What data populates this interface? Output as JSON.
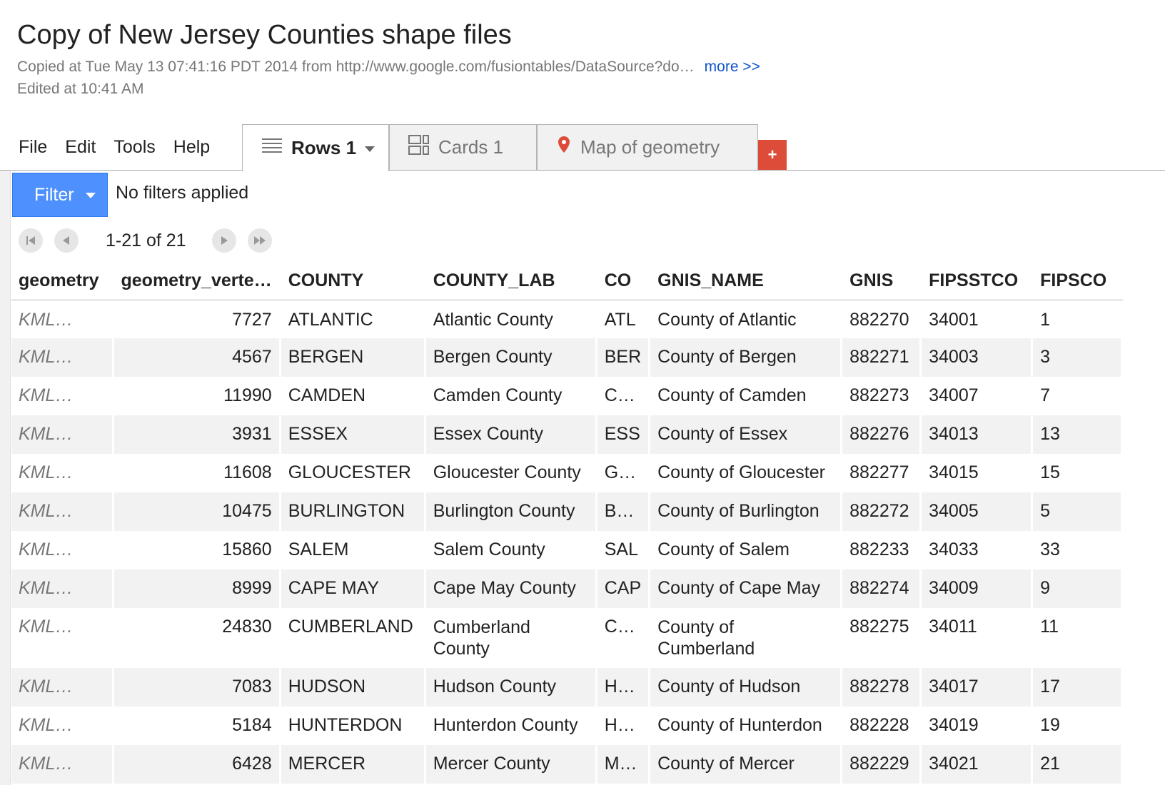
{
  "header": {
    "title": "Copy of New Jersey Counties shape files",
    "copied_text": "Copied at Tue May 13 07:41:16 PDT 2014 from http://www.google.com/fusiontables/DataSource?do…",
    "more_link": "more >>",
    "edited_text": "Edited at 10:41 AM"
  },
  "menu": {
    "items": [
      "File",
      "Edit",
      "Tools",
      "Help"
    ]
  },
  "tabs": [
    {
      "label": "Rows 1",
      "icon": "rows-list-icon",
      "active": true
    },
    {
      "label": "Cards 1",
      "icon": "cards-icon",
      "active": false
    },
    {
      "label": "Map of geometry",
      "icon": "map-pin-icon",
      "active": false
    }
  ],
  "add_tab_label": "+",
  "filter": {
    "button_label": "Filter",
    "status": "No filters applied"
  },
  "pager": {
    "range_text": "1-21 of 21"
  },
  "colors": {
    "filter_button": "#4d90fe",
    "add_tab": "#dd4b39",
    "link": "#1155cc",
    "map_pin": "#dd4b39"
  },
  "table": {
    "columns": [
      "geometry",
      "geometry_verte…",
      "COUNTY",
      "COUNTY_LAB",
      "CO",
      "GNIS_NAME",
      "GNIS",
      "FIPSSTCO",
      "FIPSCO"
    ],
    "rows": [
      [
        "KML…",
        "7727",
        "ATLANTIC",
        "Atlantic County",
        "ATL",
        "County of Atlantic",
        "882270",
        "34001",
        "1"
      ],
      [
        "KML…",
        "4567",
        "BERGEN",
        "Bergen County",
        "BER",
        "County of Bergen",
        "882271",
        "34003",
        "3"
      ],
      [
        "KML…",
        "11990",
        "CAMDEN",
        "Camden County",
        "C…",
        "County of Camden",
        "882273",
        "34007",
        "7"
      ],
      [
        "KML…",
        "3931",
        "ESSEX",
        "Essex County",
        "ESS",
        "County of Essex",
        "882276",
        "34013",
        "13"
      ],
      [
        "KML…",
        "11608",
        "GLOUCESTER",
        "Gloucester County",
        "G…",
        "County of Gloucester",
        "882277",
        "34015",
        "15"
      ],
      [
        "KML…",
        "10475",
        "BURLINGTON",
        "Burlington County",
        "B…",
        "County of Burlington",
        "882272",
        "34005",
        "5"
      ],
      [
        "KML…",
        "15860",
        "SALEM",
        "Salem County",
        "SAL",
        "County of Salem",
        "882233",
        "34033",
        "33"
      ],
      [
        "KML…",
        "8999",
        "CAPE MAY",
        "Cape May County",
        "CAP",
        "County of Cape May",
        "882274",
        "34009",
        "9"
      ],
      [
        "KML…",
        "24830",
        "CUMBERLAND",
        "Cumberland County",
        "C…",
        "County of Cumberland",
        "882275",
        "34011",
        "11"
      ],
      [
        "KML…",
        "7083",
        "HUDSON",
        "Hudson County",
        "H…",
        "County of Hudson",
        "882278",
        "34017",
        "17"
      ],
      [
        "KML…",
        "5184",
        "HUNTERDON",
        "Hunterdon County",
        "H…",
        "County of Hunterdon",
        "882228",
        "34019",
        "19"
      ],
      [
        "KML…",
        "6428",
        "MERCER",
        "Mercer County",
        "M…",
        "County of Mercer",
        "882229",
        "34021",
        "21"
      ]
    ]
  }
}
